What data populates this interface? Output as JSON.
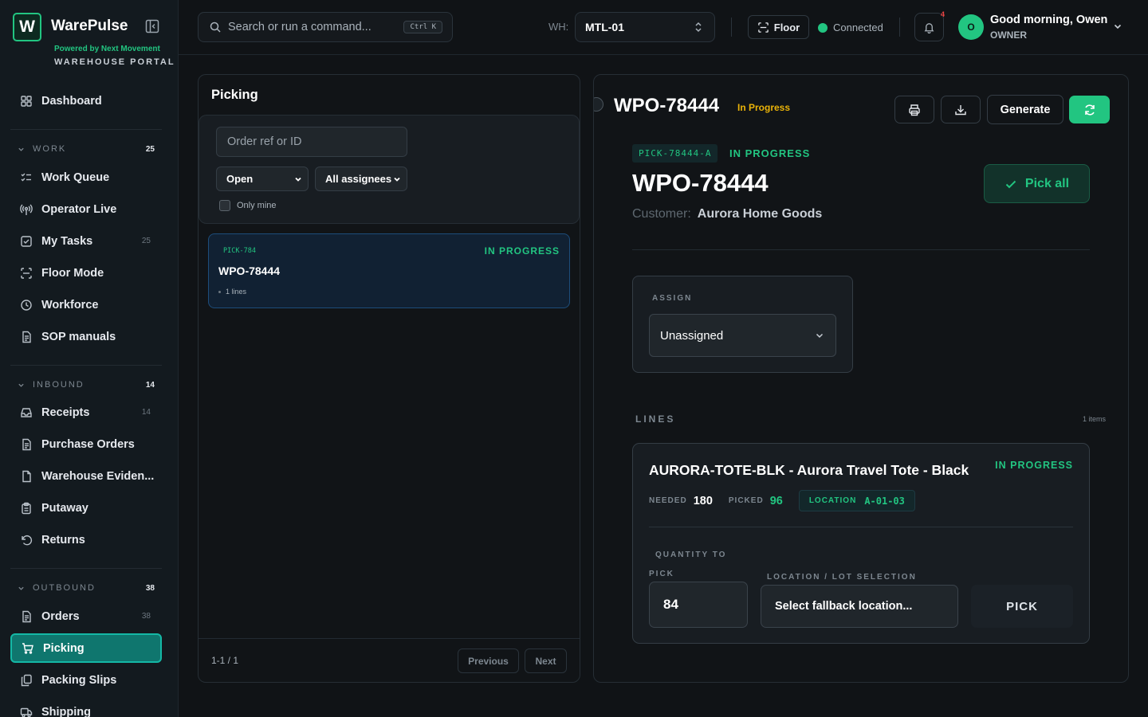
{
  "brand": {
    "name": "WarePulse",
    "logo_letter": "W",
    "powered": "Powered by Next Movement",
    "portal": "WAREHOUSE PORTAL"
  },
  "sidebar": {
    "dashboard": "Dashboard",
    "work": {
      "label": "WORK",
      "count": "25",
      "items": [
        {
          "label": "Work Queue"
        },
        {
          "label": "Operator Live"
        },
        {
          "label": "My Tasks",
          "count": "25"
        },
        {
          "label": "Floor Mode"
        },
        {
          "label": "Workforce"
        },
        {
          "label": "SOP manuals"
        }
      ]
    },
    "inbound": {
      "label": "INBOUND",
      "count": "14",
      "items": [
        {
          "label": "Receipts",
          "count": "14"
        },
        {
          "label": "Purchase Orders"
        },
        {
          "label": "Warehouse Eviden..."
        },
        {
          "label": "Putaway"
        },
        {
          "label": "Returns"
        }
      ]
    },
    "outbound": {
      "label": "OUTBOUND",
      "count": "38",
      "items": [
        {
          "label": "Orders",
          "count": "38"
        },
        {
          "label": "Picking"
        },
        {
          "label": "Packing Slips"
        },
        {
          "label": "Shipping"
        }
      ]
    }
  },
  "topbar": {
    "search_placeholder": "Search or run a command...",
    "shortcut": "Ctrl K",
    "wh_label": "WH:",
    "warehouse": "MTL-01",
    "floor": "Floor",
    "connection": "Connected",
    "notif_count": "4",
    "avatar_initial": "O",
    "greeting": "Good morning, Owen",
    "role": "OWNER"
  },
  "list": {
    "title": "Picking",
    "search_placeholder": "Order ref or ID",
    "status_filter": "Open",
    "assignee_filter": "All assignees",
    "only_mine": "Only mine",
    "cards": [
      {
        "ref": "PICK-784",
        "status": "IN PROGRESS",
        "order": "WPO-78444",
        "lines": "1 lines"
      }
    ],
    "range": "1-1 / 1",
    "prev": "Previous",
    "next": "Next"
  },
  "detail": {
    "title": "WPO-78444",
    "badge": "In Progress",
    "generate": "Generate",
    "pick_ref": "PICK-78444-A",
    "pick_status": "IN PROGRESS",
    "order": "WPO-78444",
    "customer_label": "Customer:",
    "customer": "Aurora Home Goods",
    "pick_all": "Pick all",
    "assign_label": "ASSIGN",
    "assignee": "Unassigned",
    "lines_label": "LINES",
    "lines_count": "1 items",
    "line": {
      "title": "AURORA-TOTE-BLK - Aurora Travel Tote - Black",
      "status": "IN PROGRESS",
      "needed_label": "NEEDED",
      "needed": "180",
      "picked_label": "PICKED",
      "picked": "96",
      "location_label": "LOCATION",
      "location": "A-01-03",
      "qty_label_1": "QUANTITY TO",
      "qty_label_2": "PICK",
      "qty": "84",
      "loc_select_label": "LOCATION / LOT SELECTION",
      "loc_select": "Select fallback location...",
      "pick_button": "PICK"
    }
  },
  "colors": {
    "accent": "#22c581",
    "active_nav": "#0f766e",
    "warning": "#eab308"
  }
}
